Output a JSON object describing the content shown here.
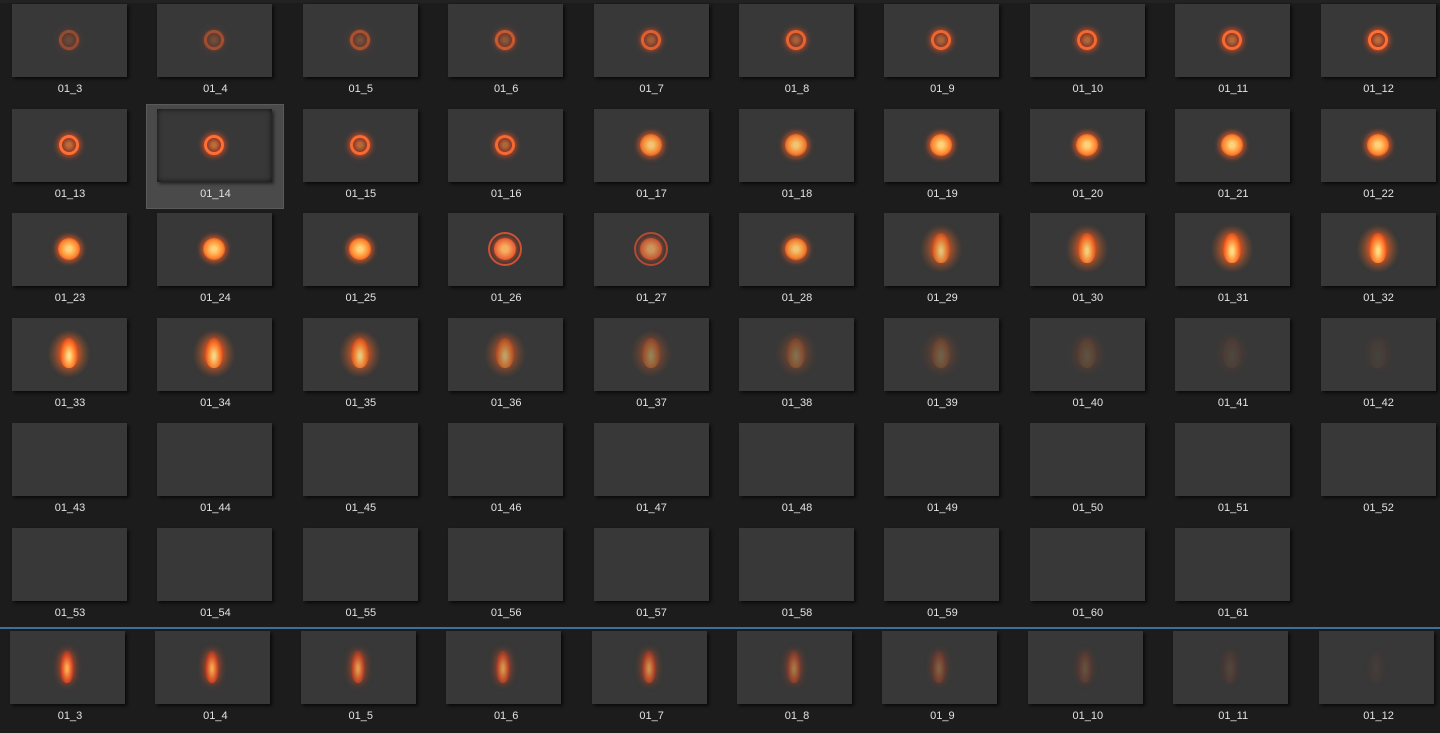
{
  "grid_one": {
    "selected_label": "01_14",
    "items": [
      {
        "label": "01_3",
        "fx": "ring",
        "level": 0.35
      },
      {
        "label": "01_4",
        "fx": "ring",
        "level": 0.4
      },
      {
        "label": "01_5",
        "fx": "ring",
        "level": 0.45
      },
      {
        "label": "01_6",
        "fx": "ring",
        "level": 0.6
      },
      {
        "label": "01_7",
        "fx": "ring",
        "level": 0.75
      },
      {
        "label": "01_8",
        "fx": "ring",
        "level": 0.8
      },
      {
        "label": "01_9",
        "fx": "ring",
        "level": 0.85
      },
      {
        "label": "01_10",
        "fx": "ring",
        "level": 0.9
      },
      {
        "label": "01_11",
        "fx": "ring",
        "level": 0.95
      },
      {
        "label": "01_12",
        "fx": "ring",
        "level": 1.0
      },
      {
        "label": "01_13",
        "fx": "ring",
        "level": 1.0
      },
      {
        "label": "01_14",
        "fx": "ring",
        "level": 1.0
      },
      {
        "label": "01_15",
        "fx": "ring",
        "level": 0.95
      },
      {
        "label": "01_16",
        "fx": "ring",
        "level": 0.9
      },
      {
        "label": "01_17",
        "fx": "orb",
        "level": 0.9
      },
      {
        "label": "01_18",
        "fx": "orb",
        "level": 0.9
      },
      {
        "label": "01_19",
        "fx": "orb",
        "level": 1.0
      },
      {
        "label": "01_20",
        "fx": "orb",
        "level": 1.0
      },
      {
        "label": "01_21",
        "fx": "orb",
        "level": 1.0
      },
      {
        "label": "01_22",
        "fx": "orb",
        "level": 1.0
      },
      {
        "label": "01_23",
        "fx": "orb",
        "level": 1.0
      },
      {
        "label": "01_24",
        "fx": "orb",
        "level": 1.0
      },
      {
        "label": "01_25",
        "fx": "orb",
        "level": 1.0
      },
      {
        "label": "01_26",
        "fx": "halo",
        "level": 0.95
      },
      {
        "label": "01_27",
        "fx": "halo",
        "level": 0.75
      },
      {
        "label": "01_28",
        "fx": "orb",
        "level": 0.9
      },
      {
        "label": "01_29",
        "fx": "flame",
        "level": 0.8
      },
      {
        "label": "01_30",
        "fx": "flame",
        "level": 0.9
      },
      {
        "label": "01_31",
        "fx": "flame",
        "level": 1.0
      },
      {
        "label": "01_32",
        "fx": "flame",
        "level": 1.0
      },
      {
        "label": "01_33",
        "fx": "flame",
        "level": 1.0
      },
      {
        "label": "01_34",
        "fx": "flame",
        "level": 0.95
      },
      {
        "label": "01_35",
        "fx": "flame",
        "level": 0.85
      },
      {
        "label": "01_36",
        "fx": "flame",
        "level": 0.6
      },
      {
        "label": "01_37",
        "fx": "flame",
        "level": 0.4
      },
      {
        "label": "01_38",
        "fx": "flame",
        "level": 0.3
      },
      {
        "label": "01_39",
        "fx": "flame",
        "level": 0.22
      },
      {
        "label": "01_40",
        "fx": "flame",
        "level": 0.14
      },
      {
        "label": "01_41",
        "fx": "flame",
        "level": 0.08
      },
      {
        "label": "01_42",
        "fx": "flame",
        "level": 0.04
      },
      {
        "label": "01_43",
        "fx": "none",
        "level": 0
      },
      {
        "label": "01_44",
        "fx": "none",
        "level": 0
      },
      {
        "label": "01_45",
        "fx": "none",
        "level": 0
      },
      {
        "label": "01_46",
        "fx": "none",
        "level": 0
      },
      {
        "label": "01_47",
        "fx": "none",
        "level": 0
      },
      {
        "label": "01_48",
        "fx": "none",
        "level": 0
      },
      {
        "label": "01_49",
        "fx": "none",
        "level": 0
      },
      {
        "label": "01_50",
        "fx": "none",
        "level": 0
      },
      {
        "label": "01_51",
        "fx": "none",
        "level": 0
      },
      {
        "label": "01_52",
        "fx": "none",
        "level": 0
      },
      {
        "label": "01_53",
        "fx": "none",
        "level": 0
      },
      {
        "label": "01_54",
        "fx": "none",
        "level": 0
      },
      {
        "label": "01_55",
        "fx": "none",
        "level": 0
      },
      {
        "label": "01_56",
        "fx": "none",
        "level": 0
      },
      {
        "label": "01_57",
        "fx": "none",
        "level": 0
      },
      {
        "label": "01_58",
        "fx": "none",
        "level": 0
      },
      {
        "label": "01_59",
        "fx": "none",
        "level": 0
      },
      {
        "label": "01_60",
        "fx": "none",
        "level": 0
      },
      {
        "label": "01_61",
        "fx": "none",
        "level": 0
      }
    ]
  },
  "grid_two": {
    "items": [
      {
        "label": "01_3",
        "fx": "spark",
        "level": 1.0
      },
      {
        "label": "01_4",
        "fx": "spark",
        "level": 0.95
      },
      {
        "label": "01_5",
        "fx": "spark",
        "level": 0.85
      },
      {
        "label": "01_6",
        "fx": "spark",
        "level": 0.8
      },
      {
        "label": "01_7",
        "fx": "spark",
        "level": 0.75
      },
      {
        "label": "01_8",
        "fx": "spark",
        "level": 0.55
      },
      {
        "label": "01_9",
        "fx": "spark",
        "level": 0.35
      },
      {
        "label": "01_10",
        "fx": "spark",
        "level": 0.22
      },
      {
        "label": "01_11",
        "fx": "spark",
        "level": 0.12
      },
      {
        "label": "01_12",
        "fx": "spark",
        "level": 0.05
      }
    ]
  },
  "colors": {
    "background": "#1c1c1c",
    "thumb_bg": "#383838",
    "selection": "#4a4a4a",
    "separator": "#3f6e9c",
    "label_text": "#e2e2e2",
    "fx_core": "#ff9a3c",
    "fx_glow": "#ff4a1a"
  }
}
